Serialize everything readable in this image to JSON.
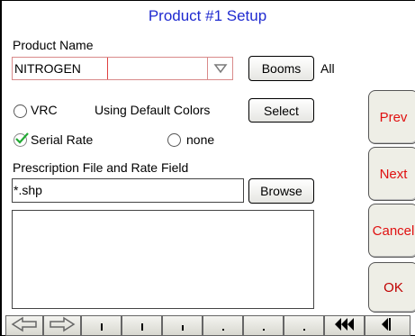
{
  "window": {
    "title": "Product #1 Setup"
  },
  "product_name": {
    "label": "Product Name",
    "value": "NITROGEN"
  },
  "booms": {
    "button_label": "Booms",
    "value_text": "All"
  },
  "vrc": {
    "radio_label": "VRC",
    "colors_text": "Using Default Colors",
    "select_label": "Select"
  },
  "rate_options": {
    "serial_label": "Serial Rate",
    "none_label": "none"
  },
  "prescription": {
    "label": "Prescription File and Rate Field",
    "file_value": "*.shp",
    "browse_label": "Browse"
  },
  "side_buttons": {
    "prev": "Prev",
    "next": "Next",
    "cancel": "Cancel",
    "ok": "OK"
  },
  "toolbar": {
    "icons": [
      "left-arrow-icon",
      "right-arrow-icon",
      "key-icon",
      "key-icon",
      "key-icon",
      "key-icon",
      "key-icon",
      "key-icon",
      "rewind-icon",
      "skip-back-icon"
    ]
  },
  "colors": {
    "title": "#1f2ad0",
    "side_button_text": "#e01010",
    "check": "#22aa33",
    "combo_border": "#d98a8a"
  }
}
